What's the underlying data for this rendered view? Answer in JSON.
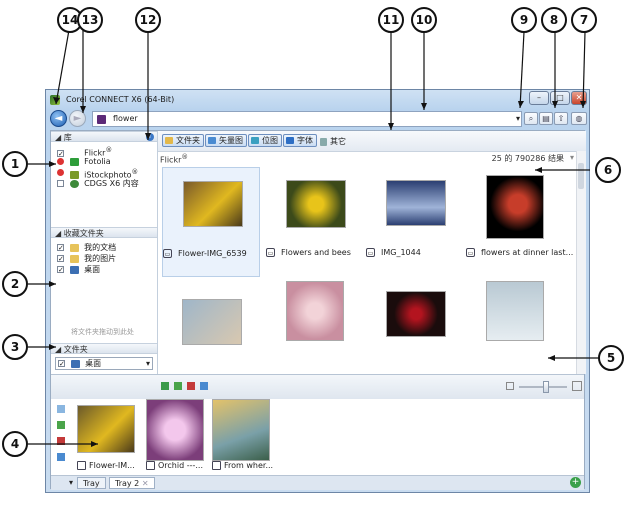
{
  "window": {
    "title": "Corel CONNECT X6 (64-Bit)",
    "minimize": "–",
    "maximize": "□",
    "close": "✕"
  },
  "nav": {
    "back_icon": "arrow-left",
    "forward_icon": "arrow-right",
    "search_value": "flower",
    "dropdown_arrow": "▾"
  },
  "toolbar": {
    "search_icon": "magnifier",
    "b8_icon": "tray-upload",
    "b7_icon": "globe"
  },
  "library": {
    "header": "库",
    "items": [
      {
        "label": "Flickr",
        "checked": true,
        "sup": "®"
      },
      {
        "label": "Fotolia",
        "checked": false
      },
      {
        "label": "iStockphoto",
        "checked": false,
        "sup": "®"
      },
      {
        "label": "CDGS X6 内容",
        "checked": false
      }
    ]
  },
  "favorites": {
    "header": "收藏文件夹",
    "items": [
      {
        "label": "我的文档",
        "checked": true
      },
      {
        "label": "我的图片",
        "checked": true
      },
      {
        "label": "桌面",
        "checked": true
      }
    ],
    "hint": "将文件夹拖动到此处"
  },
  "folders": {
    "header": "文件夹",
    "current": "桌面"
  },
  "filters": {
    "items": [
      "文件夹",
      "矢量图",
      "位图",
      "字体",
      "其它"
    ]
  },
  "results": {
    "source": "Flickr",
    "source_sup": "®",
    "count": "25 的 790286 结果"
  },
  "thumbnails": [
    {
      "caption": "Flower-IMG_6539",
      "color1": "#7a5a2a",
      "color2": "#e0b820"
    },
    {
      "caption": "Flowers and bees",
      "color1": "#3c4a1a",
      "color2": "#e8c41a"
    },
    {
      "caption": "IMG_1044",
      "color1": "#2b3f72",
      "color2": "#9fb3d8"
    },
    {
      "caption": "flowers at dinner last...",
      "color1": "#000000",
      "color2": "#c73d2a"
    },
    {
      "caption": "",
      "color1": "#9fb6c9",
      "color2": "#d8c8b0"
    },
    {
      "caption": "",
      "color1": "#c98fa0",
      "color2": "#f2d3d8"
    },
    {
      "caption": "",
      "color1": "#1a0c0c",
      "color2": "#b3141f"
    },
    {
      "caption": "",
      "color1": "#b9c9d3",
      "color2": "#e6edf1"
    }
  ],
  "tray": {
    "items": [
      {
        "caption": "Flower-IM...",
        "color1": "#6b5a2a",
        "color2": "#e0b820"
      },
      {
        "caption": "Orchid ---...",
        "color1": "#7c3e7a",
        "color2": "#f3c7ec"
      },
      {
        "caption": "From wher...",
        "color1": "#7aa0a8",
        "color2": "#e3c26a"
      }
    ],
    "tabs": [
      "Tray",
      "Tray 2"
    ],
    "tab_close": "✕",
    "add": "+"
  },
  "callouts": [
    "1",
    "2",
    "3",
    "4",
    "5",
    "6",
    "7",
    "8",
    "9",
    "10",
    "11",
    "12",
    "13",
    "14"
  ]
}
